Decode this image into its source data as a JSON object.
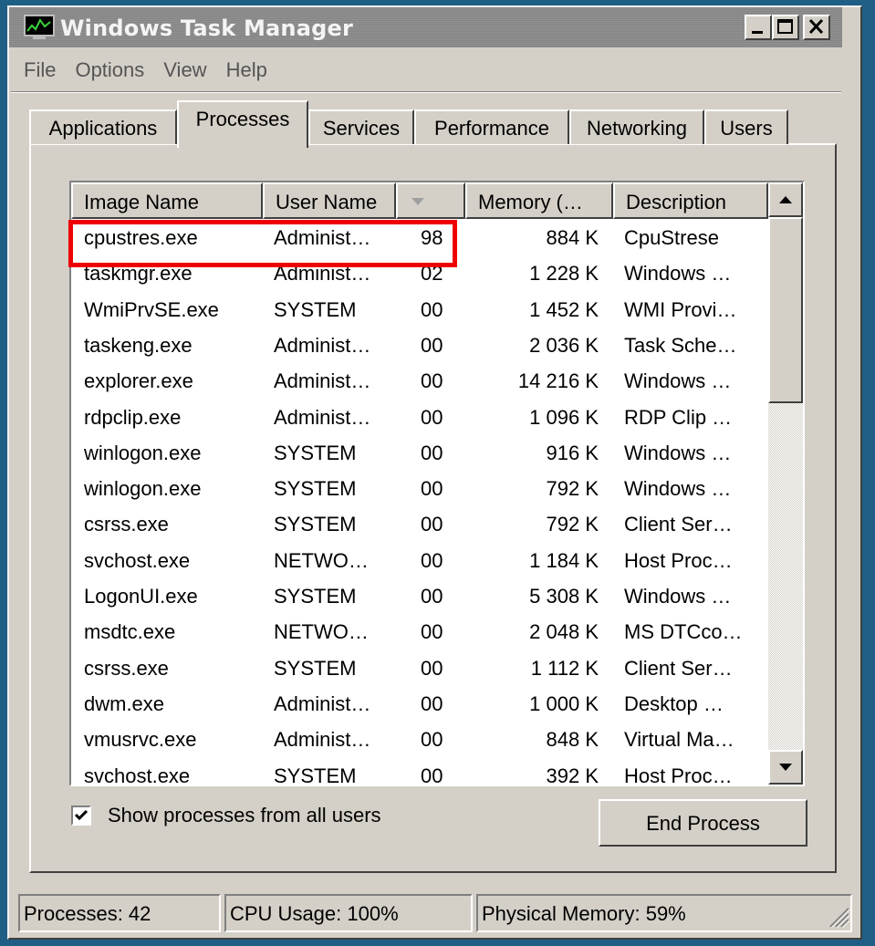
{
  "window": {
    "title": "Windows Task Manager"
  },
  "menu": [
    "File",
    "Options",
    "View",
    "Help"
  ],
  "tabs": [
    "Applications",
    "Processes",
    "Services",
    "Performance",
    "Networking",
    "Users"
  ],
  "active_tab": "Processes",
  "table": {
    "headers": {
      "image_name": "Image Name",
      "user_name": "User Name",
      "cpu": "",
      "memory": "Memory (…",
      "description": "Description"
    },
    "sort_indicator": "sort-descending-icon",
    "rows": [
      {
        "name": "cpustres.exe",
        "user": "Administ…",
        "cpu": "98",
        "mem": "884 K",
        "desc": "CpuStrese"
      },
      {
        "name": "taskmgr.exe",
        "user": "Administ…",
        "cpu": "02",
        "mem": "1 228 K",
        "desc": "Windows …"
      },
      {
        "name": "WmiPrvSE.exe",
        "user": "SYSTEM",
        "cpu": "00",
        "mem": "1 452 K",
        "desc": "WMI Provi…"
      },
      {
        "name": "taskeng.exe",
        "user": "Administ…",
        "cpu": "00",
        "mem": "2 036 K",
        "desc": "Task Sche…"
      },
      {
        "name": "explorer.exe",
        "user": "Administ…",
        "cpu": "00",
        "mem": "14 216 K",
        "desc": "Windows …"
      },
      {
        "name": "rdpclip.exe",
        "user": "Administ…",
        "cpu": "00",
        "mem": "1 096 K",
        "desc": "RDP Clip …"
      },
      {
        "name": "winlogon.exe",
        "user": "SYSTEM",
        "cpu": "00",
        "mem": "916 K",
        "desc": "Windows …"
      },
      {
        "name": "winlogon.exe",
        "user": "SYSTEM",
        "cpu": "00",
        "mem": "792 K",
        "desc": "Windows …"
      },
      {
        "name": "csrss.exe",
        "user": "SYSTEM",
        "cpu": "00",
        "mem": "792 K",
        "desc": "Client Ser…"
      },
      {
        "name": "svchost.exe",
        "user": "NETWO…",
        "cpu": "00",
        "mem": "1 184 K",
        "desc": "Host Proc…"
      },
      {
        "name": "LogonUI.exe",
        "user": "SYSTEM",
        "cpu": "00",
        "mem": "5 308 K",
        "desc": "Windows …"
      },
      {
        "name": "msdtc.exe",
        "user": "NETWO…",
        "cpu": "00",
        "mem": "2 048 K",
        "desc": "MS DTCco…"
      },
      {
        "name": "csrss.exe",
        "user": "SYSTEM",
        "cpu": "00",
        "mem": "1 112 K",
        "desc": "Client Ser…"
      },
      {
        "name": "dwm.exe",
        "user": "Administ…",
        "cpu": "00",
        "mem": "1 000 K",
        "desc": "Desktop …"
      },
      {
        "name": "vmusrvc.exe",
        "user": "Administ…",
        "cpu": "00",
        "mem": "848 K",
        "desc": "Virtual Ma…"
      },
      {
        "name": "svchost.exe",
        "user": "SYSTEM",
        "cpu": "00",
        "mem": "392 K",
        "desc": "Host Proc…"
      }
    ]
  },
  "show_all_users": {
    "label": "Show processes from all users",
    "checked": true
  },
  "end_process_label": "End Process",
  "status": {
    "processes": "Processes: 42",
    "cpu_usage": "CPU Usage: 100%",
    "physical_memory": "Physical Memory: 59%"
  },
  "colors": {
    "desktop": "#1f5f86",
    "face": "#d4d0c8",
    "highlight_box": "#ee0000",
    "titlebar_inactive": "#8a8a8a"
  }
}
